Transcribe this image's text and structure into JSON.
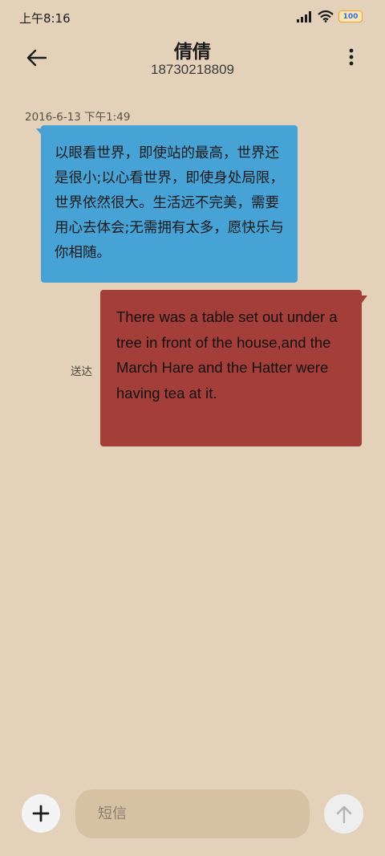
{
  "status_bar": {
    "time": "上午8:16",
    "battery_level": "100",
    "icons": [
      "signal-icon",
      "wifi-icon",
      "battery-icon"
    ]
  },
  "header": {
    "contact_name": "倩倩",
    "contact_number": "18730218809",
    "back_icon": "back-arrow-icon",
    "more_icon": "more-vertical-icon"
  },
  "messages": {
    "timestamp": "2016-6-13 下午1:49",
    "incoming": {
      "text": "以眼看世界，即使站的最高，世界还是很小;以心看世界，即使身处局限，世界依然很大。生活远不完美，需要用心去体会;无需拥有太多，愿快乐与你相随。",
      "color": "#47a3d6"
    },
    "outgoing": {
      "text": "There was a table set out under a tree in front of the house,and the March Hare and the Hatter were having tea at it.",
      "status": "送达",
      "color": "#a43e38"
    }
  },
  "composer": {
    "add_icon": "plus-icon",
    "placeholder": "短信",
    "value": "",
    "send_icon": "arrow-up-icon"
  },
  "colors": {
    "background": "#e3d2b9",
    "input_background": "#d6c2a3"
  }
}
